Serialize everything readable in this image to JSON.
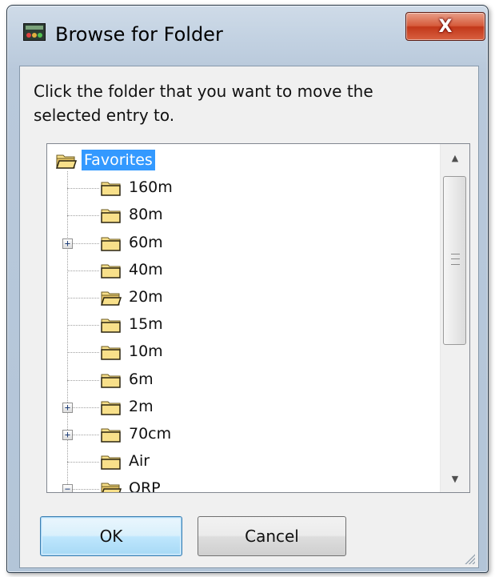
{
  "window": {
    "title": "Browse for Folder",
    "close_label": "X"
  },
  "instruction": "Click the folder that you want to move the selected entry to.",
  "tree": {
    "items": [
      {
        "label": "Favorites",
        "level": 0,
        "expander": "none",
        "open_folder": true,
        "selected": true
      },
      {
        "label": "160m",
        "level": 1,
        "expander": "none",
        "open_folder": false,
        "selected": false
      },
      {
        "label": "80m",
        "level": 1,
        "expander": "none",
        "open_folder": false,
        "selected": false
      },
      {
        "label": "60m",
        "level": 1,
        "expander": "+",
        "open_folder": false,
        "selected": false
      },
      {
        "label": "40m",
        "level": 1,
        "expander": "none",
        "open_folder": false,
        "selected": false
      },
      {
        "label": "20m",
        "level": 1,
        "expander": "none",
        "open_folder": true,
        "selected": false
      },
      {
        "label": "15m",
        "level": 1,
        "expander": "none",
        "open_folder": false,
        "selected": false
      },
      {
        "label": "10m",
        "level": 1,
        "expander": "none",
        "open_folder": false,
        "selected": false
      },
      {
        "label": "6m",
        "level": 1,
        "expander": "none",
        "open_folder": false,
        "selected": false
      },
      {
        "label": "2m",
        "level": 1,
        "expander": "+",
        "open_folder": false,
        "selected": false
      },
      {
        "label": "70cm",
        "level": 1,
        "expander": "+",
        "open_folder": false,
        "selected": false
      },
      {
        "label": "Air",
        "level": 1,
        "expander": "none",
        "open_folder": false,
        "selected": false
      },
      {
        "label": "QRP",
        "level": 1,
        "expander": "−",
        "open_folder": true,
        "selected": false
      }
    ]
  },
  "buttons": {
    "ok": "OK",
    "cancel": "Cancel"
  },
  "colors": {
    "selection": "#3399ff",
    "folder_fill": "#f8e08a",
    "close_button": "#c2381a"
  },
  "icons": {
    "app": "radio-app-icon",
    "folder": "folder-icon",
    "open_folder": "open-folder-icon"
  }
}
